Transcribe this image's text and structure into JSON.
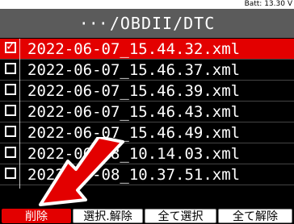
{
  "status": {
    "battery": "Batt: 13.30 V"
  },
  "path": {
    "ellipsis": "···",
    "text": "/OBDII/DTC"
  },
  "files": [
    {
      "name": "2022-06-07_15.44.32.xml",
      "checked": true
    },
    {
      "name": "2022-06-07_15.46.37.xml",
      "checked": false
    },
    {
      "name": "2022-06-07_15.46.39.xml",
      "checked": false
    },
    {
      "name": "2022-06-07_15.46.43.xml",
      "checked": false
    },
    {
      "name": "2022-06-07_15.46.49.xml",
      "checked": false
    },
    {
      "name": "2022-06-08_10.14.03.xml",
      "checked": false
    },
    {
      "name": "2022-06-08_10.37.51.xml",
      "checked": false
    }
  ],
  "footer": {
    "delete": "削除",
    "toggle": "選択.解除",
    "select_all": "全て選択",
    "deselect_all": "全て解除"
  },
  "colors": {
    "accent": "#e30000",
    "path_bar": "#5b5b5b"
  }
}
